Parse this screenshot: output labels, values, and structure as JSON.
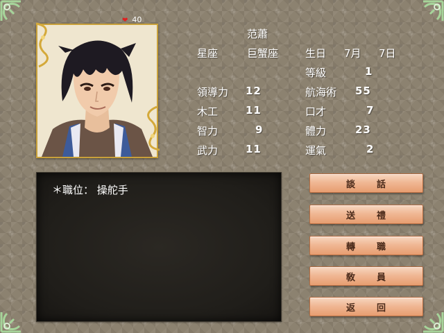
{
  "hp": {
    "value": "40"
  },
  "character": {
    "name": "范蕭",
    "zodiac_label": "星座",
    "zodiac_value": "巨蟹座",
    "birthday_label": "生日",
    "birthday_month": "7月",
    "birthday_day": "7日",
    "level_label": "等級",
    "level_value": "1",
    "leadership_label": "領導力",
    "leadership_value": "12",
    "navigation_label": "航海術",
    "navigation_value": "55",
    "carpentry_label": "木工",
    "carpentry_value": "11",
    "eloquence_label": "口才",
    "eloquence_value": "7",
    "intellect_label": "智力",
    "intellect_value": "9",
    "stamina_label": "體力",
    "stamina_value": "23",
    "martial_label": "武力",
    "martial_value": "11",
    "luck_label": "運氣",
    "luck_value": "2"
  },
  "info": {
    "position_line": "＊職位： 操舵手"
  },
  "menu": {
    "talk": [
      "談",
      "話"
    ],
    "gift": [
      "送",
      "禮"
    ],
    "change_job": [
      "轉",
      "職"
    ],
    "crew": [
      "敎",
      "員"
    ],
    "back": [
      "返",
      "回"
    ]
  },
  "icons": {
    "hp": "heart-icon"
  },
  "colors": {
    "button": "#f0b895",
    "panel": "#201e1a",
    "background": "#8c8270",
    "frame": "#c9a13a"
  }
}
